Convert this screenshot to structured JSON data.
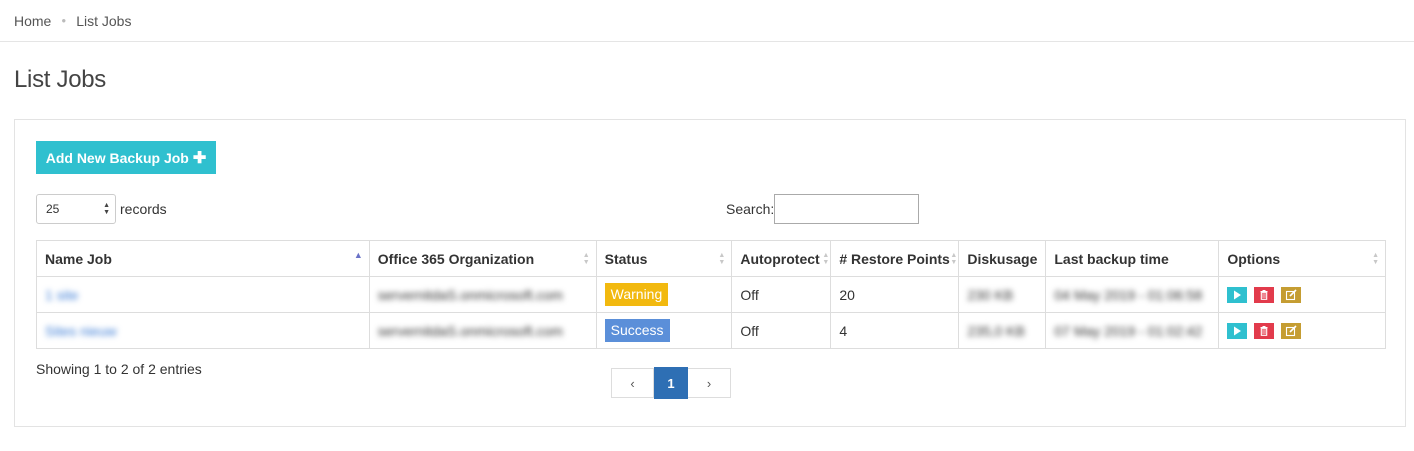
{
  "breadcrumb": {
    "home": "Home",
    "current": "List Jobs"
  },
  "page": {
    "title": "List Jobs"
  },
  "toolbar": {
    "add_label": "Add New Backup Job",
    "add_icon": "plus-icon"
  },
  "records": {
    "value": "25",
    "label": "records"
  },
  "search": {
    "label": "Search:",
    "value": "",
    "placeholder": ""
  },
  "table": {
    "columns": [
      "Name Job",
      "Office 365 Organization",
      "Status",
      "Autoprotect",
      "# Restore Points",
      "Diskusage",
      "Last backup time",
      "Options"
    ],
    "rows": [
      {
        "name": "1 site",
        "org": "servernitdaS.onmicrosoft.com",
        "status": "Warning",
        "autoprotect": "Off",
        "restore_points": "20",
        "diskusage": "230 KB",
        "last_backup": "04 May 2019 - 01:06:58"
      },
      {
        "name": "Sites nieuw",
        "org": "servernitdaS.onmicrosoft.com",
        "status": "Success",
        "autoprotect": "Off",
        "restore_points": "4",
        "diskusage": "235,0 KB",
        "last_backup": "07 May 2019 - 01:02:42"
      }
    ]
  },
  "footer": {
    "showing": "Showing 1 to 2 of 2 entries"
  },
  "pagination": {
    "prev": "‹",
    "current": "1",
    "next": "›"
  },
  "colors": {
    "accent": "#2fc0cf",
    "warning": "#f2b90f",
    "success": "#5b8fd9",
    "delete": "#e23b4c",
    "edit": "#c59d32",
    "page_active": "#2e6fb4"
  }
}
